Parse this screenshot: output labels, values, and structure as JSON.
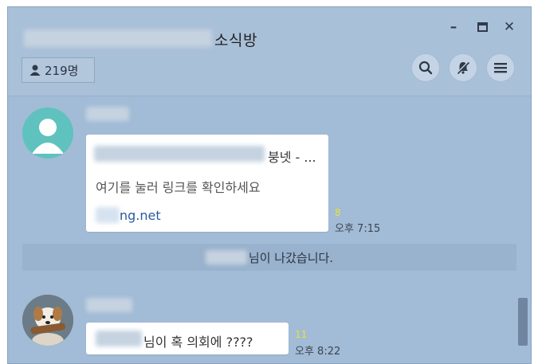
{
  "window": {
    "title": "소식방",
    "controls": {
      "minimize": "–",
      "maximize": "□",
      "close": "✕"
    }
  },
  "header": {
    "member_count": "219명",
    "icons": [
      "search-icon",
      "notification-off-icon",
      "menu-icon"
    ]
  },
  "messages": [
    {
      "avatar": "default-person-icon",
      "bubble_title_suffix": "붕넷 - ...",
      "bubble_desc": "여기를 눌러 링크를 확인하세요",
      "link_suffix": "ng.net",
      "unread": "8",
      "time": "오후 7:15"
    },
    {
      "avatar": "dog-photo",
      "text_suffix": "님이 혹 의회에 ????",
      "unread": "11",
      "time": "오후 8:22"
    }
  ],
  "system_message_suffix": "님이 나갔습니다.",
  "colors": {
    "background": "#a2bbd6",
    "bubble": "#ffffff",
    "unread": "#e8e23a",
    "link": "#2a5aa0",
    "avatar_default": "#5fc2be"
  }
}
